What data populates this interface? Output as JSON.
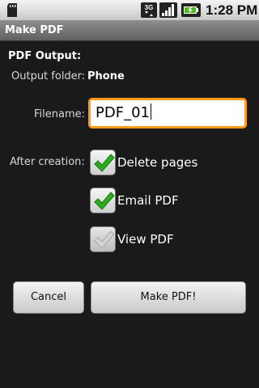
{
  "status_bar": {
    "time": "1:28 PM",
    "network_label": "3G",
    "icons": [
      "sd-card-icon",
      "3g-data-icon",
      "signal-strength-icon",
      "battery-charging-icon"
    ]
  },
  "window": {
    "title": "Make PDF"
  },
  "pdf_output": {
    "heading": "PDF Output:",
    "folder_label": "Output folder:",
    "folder_value": "Phone"
  },
  "filename": {
    "label": "Filename:",
    "value": "PDF_01"
  },
  "after_creation": {
    "label": "After creation:",
    "options": [
      {
        "label": "Delete pages",
        "checked": true,
        "enabled": true
      },
      {
        "label": "Email PDF",
        "checked": true,
        "enabled": true
      },
      {
        "label": "View PDF",
        "checked": true,
        "enabled": false
      }
    ]
  },
  "buttons": {
    "cancel": "Cancel",
    "make": "Make PDF!"
  },
  "colors": {
    "background": "#1a1a1a",
    "focus_border": "#ff9a1a",
    "check_green": "#2eaa1e",
    "check_disabled": "#c4c4c4"
  }
}
